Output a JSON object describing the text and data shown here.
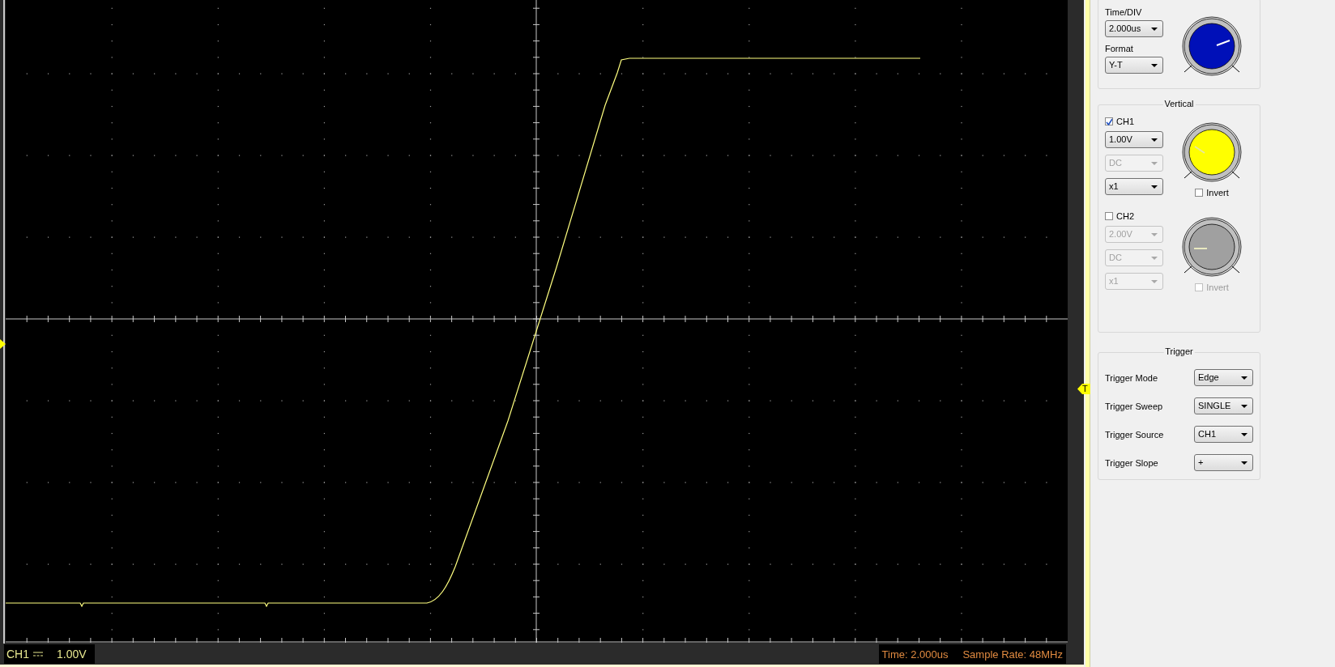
{
  "screen": {
    "trigger_marker": "T"
  },
  "status_bar": {
    "channel": "CH1",
    "scale": "1.00V",
    "time": "Time: 2.000us",
    "sample_rate": "Sample Rate: 48MHz"
  },
  "horizontal": {
    "time_div_label": "Time/DIV",
    "time_div": "2.000us",
    "format_label": "Format",
    "format": "Y-T"
  },
  "vertical": {
    "title": "Vertical",
    "channels": [
      {
        "name": "CH1",
        "checked": true,
        "volts": "1.00V",
        "volts_disabled": false,
        "coupling": "DC",
        "coupling_disabled": true,
        "probe": "x1",
        "probe_disabled": false,
        "invert_label": "Invert",
        "invert_checked": false,
        "invert_disabled": false
      },
      {
        "name": "CH2",
        "checked": false,
        "volts": "2.00V",
        "volts_disabled": true,
        "coupling": "DC",
        "coupling_disabled": true,
        "probe": "x1",
        "probe_disabled": true,
        "invert_label": "Invert",
        "invert_checked": false,
        "invert_disabled": true
      }
    ]
  },
  "trigger": {
    "title": "Trigger",
    "rows": [
      {
        "label": "Trigger Mode",
        "value": "Edge"
      },
      {
        "label": "Trigger Sweep",
        "value": "SINGLE"
      },
      {
        "label": "Trigger Source",
        "value": "CH1"
      },
      {
        "label": "Trigger Slope",
        "value": "+"
      }
    ]
  }
}
